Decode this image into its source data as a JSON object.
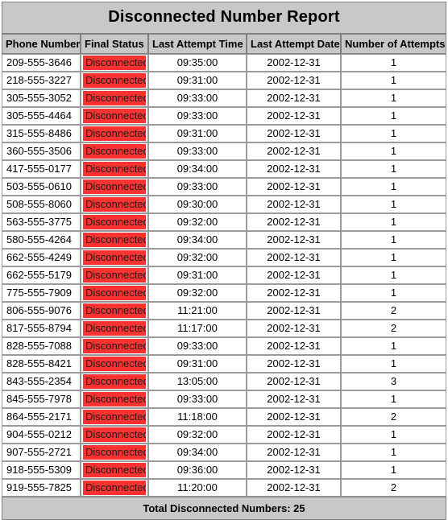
{
  "report": {
    "title": "Disconnected Number Report",
    "columns": [
      "Phone Number",
      "Final Status",
      "Last Attempt Time",
      "Last Attempt Date",
      "Number of Attempts"
    ],
    "footer": "Total Disconnected Numbers: 25",
    "colors": {
      "header_background": "#c8c8c8",
      "status_disconnected": "#fa3232",
      "border": "#9a9a9a",
      "page_background": "#ffffff"
    },
    "rows": [
      {
        "phone": "209-555-3646",
        "status": "Disconnected",
        "time": "09:35:00",
        "date": "2002-12-31",
        "attempts": "1"
      },
      {
        "phone": "218-555-3227",
        "status": "Disconnected",
        "time": "09:31:00",
        "date": "2002-12-31",
        "attempts": "1"
      },
      {
        "phone": "305-555-3052",
        "status": "Disconnected",
        "time": "09:33:00",
        "date": "2002-12-31",
        "attempts": "1"
      },
      {
        "phone": "305-555-4464",
        "status": "Disconnected",
        "time": "09:33:00",
        "date": "2002-12-31",
        "attempts": "1"
      },
      {
        "phone": "315-555-8486",
        "status": "Disconnected",
        "time": "09:31:00",
        "date": "2002-12-31",
        "attempts": "1"
      },
      {
        "phone": "360-555-3506",
        "status": "Disconnected",
        "time": "09:33:00",
        "date": "2002-12-31",
        "attempts": "1"
      },
      {
        "phone": "417-555-0177",
        "status": "Disconnected",
        "time": "09:34:00",
        "date": "2002-12-31",
        "attempts": "1"
      },
      {
        "phone": "503-555-0610",
        "status": "Disconnected",
        "time": "09:33:00",
        "date": "2002-12-31",
        "attempts": "1"
      },
      {
        "phone": "508-555-8060",
        "status": "Disconnected",
        "time": "09:30:00",
        "date": "2002-12-31",
        "attempts": "1"
      },
      {
        "phone": "563-555-3775",
        "status": "Disconnected",
        "time": "09:32:00",
        "date": "2002-12-31",
        "attempts": "1"
      },
      {
        "phone": "580-555-4264",
        "status": "Disconnected",
        "time": "09:34:00",
        "date": "2002-12-31",
        "attempts": "1"
      },
      {
        "phone": "662-555-4249",
        "status": "Disconnected",
        "time": "09:32:00",
        "date": "2002-12-31",
        "attempts": "1"
      },
      {
        "phone": "662-555-5179",
        "status": "Disconnected",
        "time": "09:31:00",
        "date": "2002-12-31",
        "attempts": "1"
      },
      {
        "phone": "775-555-7909",
        "status": "Disconnected",
        "time": "09:32:00",
        "date": "2002-12-31",
        "attempts": "1"
      },
      {
        "phone": "806-555-9076",
        "status": "Disconnected",
        "time": "11:21:00",
        "date": "2002-12-31",
        "attempts": "2"
      },
      {
        "phone": "817-555-8794",
        "status": "Disconnected",
        "time": "11:17:00",
        "date": "2002-12-31",
        "attempts": "2"
      },
      {
        "phone": "828-555-7088",
        "status": "Disconnected",
        "time": "09:33:00",
        "date": "2002-12-31",
        "attempts": "1"
      },
      {
        "phone": "828-555-8421",
        "status": "Disconnected",
        "time": "09:31:00",
        "date": "2002-12-31",
        "attempts": "1"
      },
      {
        "phone": "843-555-2354",
        "status": "Disconnected",
        "time": "13:05:00",
        "date": "2002-12-31",
        "attempts": "3"
      },
      {
        "phone": "845-555-7978",
        "status": "Disconnected",
        "time": "09:33:00",
        "date": "2002-12-31",
        "attempts": "1"
      },
      {
        "phone": "864-555-2171",
        "status": "Disconnected",
        "time": "11:18:00",
        "date": "2002-12-31",
        "attempts": "2"
      },
      {
        "phone": "904-555-0212",
        "status": "Disconnected",
        "time": "09:32:00",
        "date": "2002-12-31",
        "attempts": "1"
      },
      {
        "phone": "907-555-2721",
        "status": "Disconnected",
        "time": "09:34:00",
        "date": "2002-12-31",
        "attempts": "1"
      },
      {
        "phone": "918-555-5309",
        "status": "Disconnected",
        "time": "09:36:00",
        "date": "2002-12-31",
        "attempts": "1"
      },
      {
        "phone": "919-555-7825",
        "status": "Disconnected",
        "time": "11:20:00",
        "date": "2002-12-31",
        "attempts": "2"
      }
    ]
  }
}
